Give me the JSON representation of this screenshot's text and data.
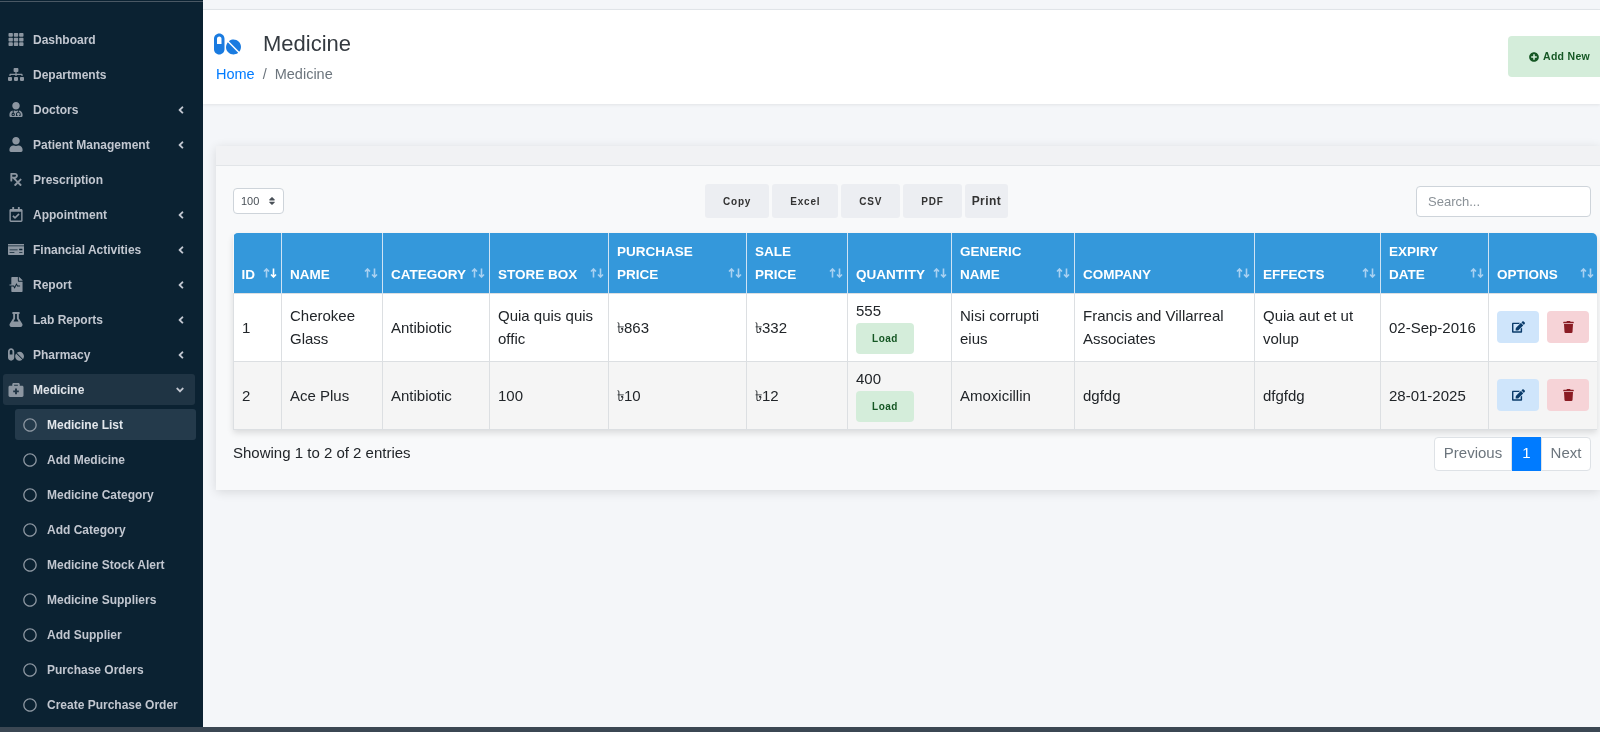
{
  "sidebar": {
    "items": [
      {
        "label": "Dashboard",
        "kind": "link",
        "selected": false
      },
      {
        "label": "Departments",
        "kind": "link",
        "selected": false
      },
      {
        "label": "Doctors",
        "kind": "menu",
        "expanded": false,
        "selected": false
      },
      {
        "label": "Patient Management",
        "kind": "menu",
        "expanded": false,
        "selected": false
      },
      {
        "label": "Prescription",
        "kind": "link",
        "selected": false
      },
      {
        "label": "Appointment",
        "kind": "menu",
        "expanded": false,
        "selected": false
      },
      {
        "label": "Financial Activities",
        "kind": "menu",
        "expanded": false,
        "selected": false
      },
      {
        "label": "Report",
        "kind": "menu",
        "expanded": false,
        "selected": false
      },
      {
        "label": "Lab Reports",
        "kind": "menu",
        "expanded": false,
        "selected": false
      },
      {
        "label": "Pharmacy",
        "kind": "menu",
        "expanded": false,
        "selected": false
      },
      {
        "label": "Medicine",
        "kind": "menu",
        "expanded": true,
        "selected": true,
        "children": [
          {
            "label": "Medicine List",
            "selected": true
          },
          {
            "label": "Add Medicine",
            "selected": false
          },
          {
            "label": "Medicine Category",
            "selected": false
          },
          {
            "label": "Add Category",
            "selected": false
          },
          {
            "label": "Medicine Stock Alert",
            "selected": false
          },
          {
            "label": "Medicine Suppliers",
            "selected": false
          },
          {
            "label": "Add Supplier",
            "selected": false
          },
          {
            "label": "Purchase Orders",
            "selected": false
          },
          {
            "label": "Create Purchase Order",
            "selected": false
          }
        ]
      }
    ]
  },
  "page_header": {
    "title": "Medicine",
    "breadcrumb": [
      {
        "label": "Home",
        "link": true
      },
      {
        "label": "Medicine",
        "link": false
      }
    ],
    "separator": "/",
    "add_button": "Add New"
  },
  "toolbar": {
    "page_length": "100",
    "buttons": [
      {
        "label": "Copy",
        "kind": "export"
      },
      {
        "label": "Excel",
        "kind": "export"
      },
      {
        "label": "CSV",
        "kind": "export"
      },
      {
        "label": "PDF",
        "kind": "export"
      },
      {
        "label": "Print",
        "kind": "print"
      }
    ],
    "search": {
      "placeholder": "Search..."
    }
  },
  "table": {
    "columns": [
      {
        "label": "ID",
        "sorted": true
      },
      {
        "label": "NAME",
        "sorted": false
      },
      {
        "label": "CATEGORY",
        "sorted": false
      },
      {
        "label": "STORE BOX",
        "sorted": false
      },
      {
        "label": "PURCHASE PRICE",
        "sorted": false
      },
      {
        "label": "SALE PRICE",
        "sorted": false
      },
      {
        "label": "QUANTITY",
        "sorted": false
      },
      {
        "label": "GENERIC NAME",
        "sorted": false
      },
      {
        "label": "COMPANY",
        "sorted": false
      },
      {
        "label": "EFFECTS",
        "sorted": false
      },
      {
        "label": "EXPIRY DATE",
        "sorted": false
      },
      {
        "label": "OPTIONS",
        "sorted": false
      }
    ],
    "rows": [
      {
        "id": "1",
        "name": "Cherokee Glass",
        "category": "Antibiotic",
        "store_box": "Quia quis quis offic",
        "purchase_price": "৳863",
        "sale_price": "৳332",
        "quantity": "555",
        "quantity_action": "Load",
        "generic_name": "Nisi corrupti eius",
        "company": "Francis and Villarreal Associates",
        "effects": "Quia aut et ut volup",
        "expiry_date": "02-Sep-2016"
      },
      {
        "id": "2",
        "name": "Ace Plus",
        "category": "Antibiotic",
        "store_box": "100",
        "purchase_price": "৳10",
        "sale_price": "৳12",
        "quantity": "400",
        "quantity_action": "Load",
        "generic_name": "Amoxicillin",
        "company": "dgfdg",
        "effects": "dfgfdg",
        "expiry_date": "28-01-2025"
      }
    ]
  },
  "footer": {
    "info": "Showing 1 to 2 of 2 entries",
    "pagination": {
      "previous": {
        "label": "Previous",
        "disabled": true
      },
      "pages": [
        {
          "label": "1",
          "selected": true
        }
      ],
      "next": {
        "label": "Next",
        "disabled": true
      }
    }
  }
}
